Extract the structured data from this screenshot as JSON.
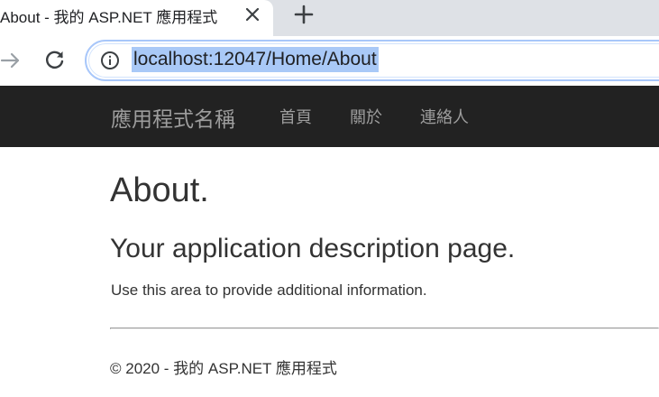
{
  "browser": {
    "tab": {
      "title": "About - 我的 ASP.NET 應用程式"
    },
    "address_bar": {
      "url": "localhost:12047/Home/About"
    }
  },
  "navbar": {
    "brand": "應用程式名稱",
    "links": [
      {
        "label": "首頁"
      },
      {
        "label": "關於"
      },
      {
        "label": "連絡人"
      }
    ]
  },
  "main": {
    "title": "About.",
    "subtitle": "Your application description page.",
    "body": "Use this area to provide additional information."
  },
  "footer": {
    "text": "© 2020 - 我的 ASP.NET 應用程式"
  },
  "icons": {
    "tab_close": "close-icon",
    "new_tab": "plus-icon",
    "forward": "arrow-right-icon",
    "reload": "reload-icon",
    "site_info": "info-icon"
  },
  "colors": {
    "navbar_bg": "#222222",
    "navbar_text": "#9d9d9d",
    "url_highlight": "#a9c9f7",
    "tabstrip_bg": "#dee1e6"
  }
}
